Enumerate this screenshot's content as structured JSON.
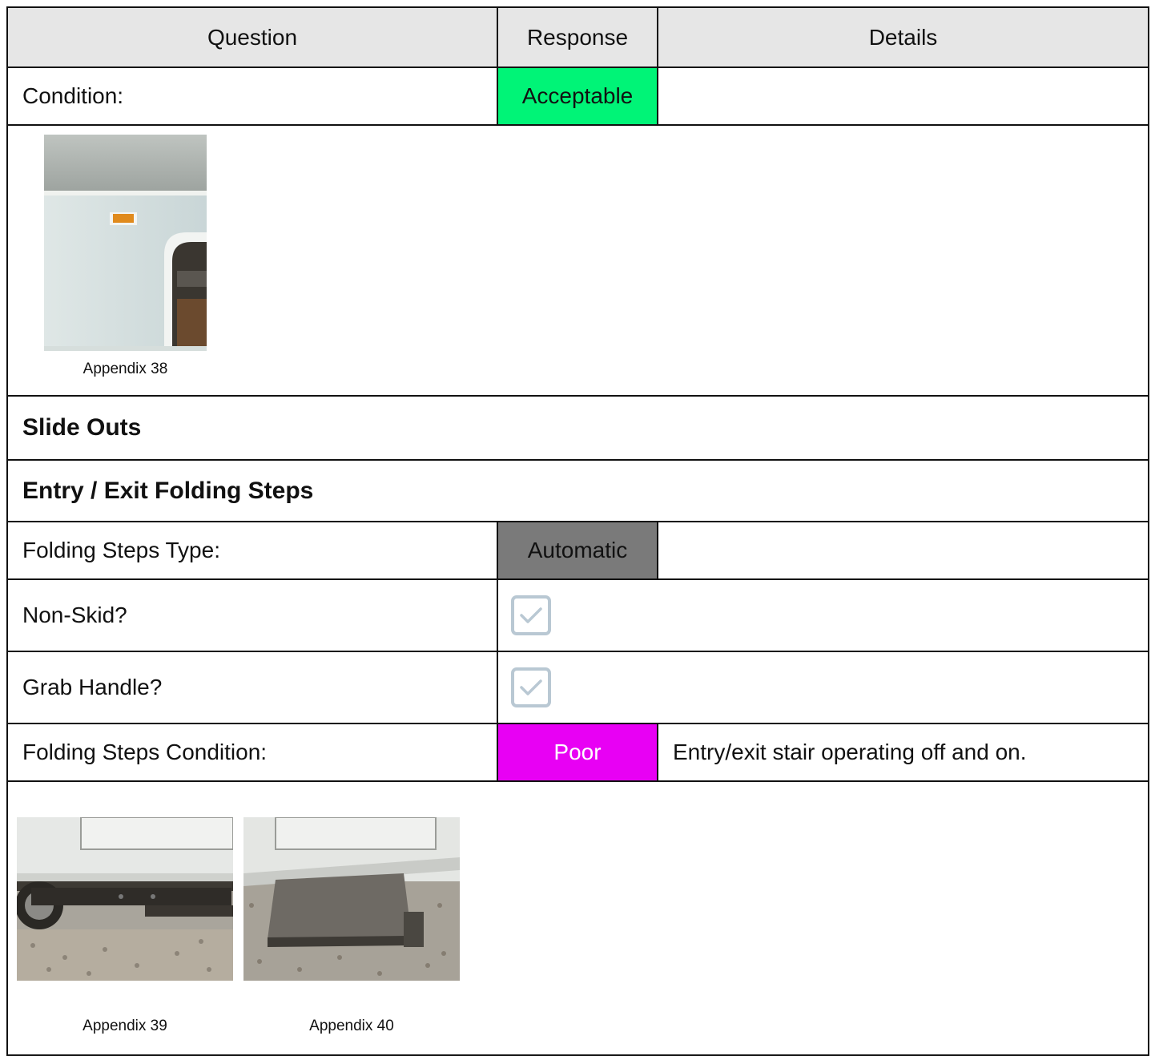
{
  "header": {
    "question": "Question",
    "response": "Response",
    "details": "Details"
  },
  "rows": {
    "condition": {
      "question": "Condition:",
      "response": "Acceptable",
      "details": ""
    },
    "slide_outs": {
      "title": "Slide Outs"
    },
    "folding_steps_section": {
      "title": "Entry / Exit Folding Steps"
    },
    "folding_steps_type": {
      "question": "Folding Steps Type:",
      "response": "Automatic",
      "details": ""
    },
    "non_skid": {
      "question": "Non-Skid?",
      "checked": true
    },
    "grab_handle": {
      "question": "Grab Handle?",
      "checked": true
    },
    "folding_steps_condition": {
      "question": "Folding Steps Condition:",
      "response": "Poor",
      "details": "Entry/exit stair operating off and on."
    }
  },
  "photos": {
    "first": [
      {
        "caption": "Appendix 38"
      }
    ],
    "second": [
      {
        "caption": "Appendix 39"
      },
      {
        "caption": "Appendix 40"
      }
    ]
  },
  "colors": {
    "acceptable": "#00f477",
    "automatic": "#7a7a7a",
    "poor": "#e800f4",
    "header_bg": "#e6e6e6",
    "checkbox": "#b9c8d3"
  },
  "icons": {
    "checkbox": "check-icon"
  }
}
